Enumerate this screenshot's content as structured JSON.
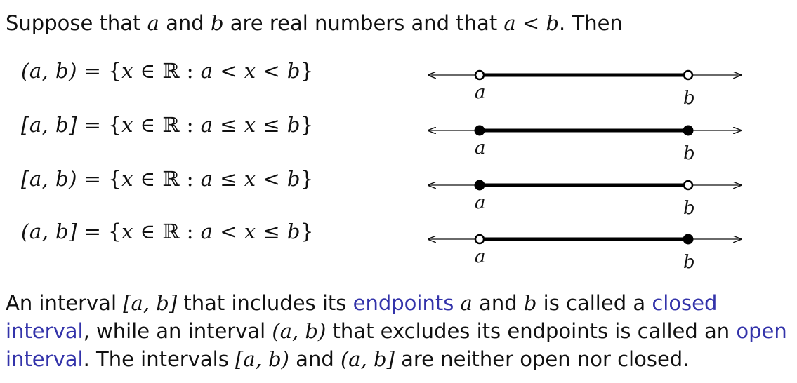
{
  "intro": {
    "t1": "Suppose that ",
    "v1": "a",
    "t2": " and ",
    "v2": "b",
    "t3": " are real numbers and that ",
    "v3": "a",
    "t4": " < ",
    "v4": "b",
    "t5": ". Then"
  },
  "definitions": [
    {
      "lhs": "(a, b)",
      "rel1": "<",
      "rel2": "<",
      "left_closed": false,
      "right_closed": false
    },
    {
      "lhs": "[a, b]",
      "rel1": "≤",
      "rel2": "≤",
      "left_closed": true,
      "right_closed": true
    },
    {
      "lhs": "[a, b)",
      "rel1": "≤",
      "rel2": "<",
      "left_closed": true,
      "right_closed": false
    },
    {
      "lhs": "(a, b]",
      "rel1": "<",
      "rel2": "≤",
      "left_closed": false,
      "right_closed": true
    }
  ],
  "set_parts": {
    "eq": " = {",
    "x": "x",
    "in": " ∈ ℝ : ",
    "a": "a",
    "b": "b",
    "close": "}"
  },
  "endpoint_labels": {
    "a": "a",
    "b": "b"
  },
  "paragraph": {
    "s1": "An interval ",
    "m1": "[a, b]",
    "s2": " that includes its ",
    "link1": "endpoints",
    "s3": " ",
    "m2": "a",
    "s4": " and ",
    "m3": "b",
    "s5": " is called a ",
    "link2": "closed interval",
    "s6": ", while an interval ",
    "m4": "(a, b)",
    "s7": " that excludes its endpoints is called an ",
    "link3": "open interval",
    "s8": ". The intervals ",
    "m5": "[a, b)",
    "s9": " and ",
    "m6": "(a, b]",
    "s10": " are neither open nor closed."
  },
  "colors": {
    "link": "#3333aa",
    "text": "#111111"
  }
}
